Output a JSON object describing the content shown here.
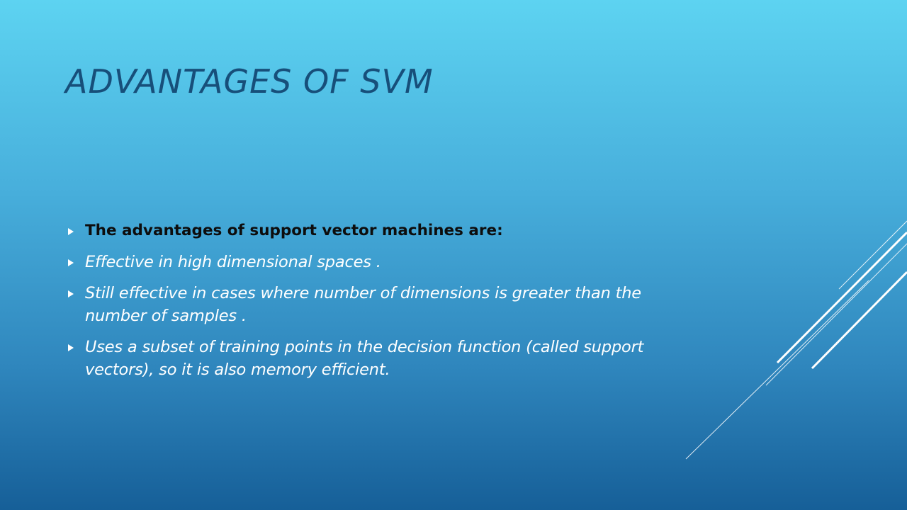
{
  "slide": {
    "title": "ADVANTAGES OF SVM",
    "bullets": [
      "The advantages of support vector machines are:",
      "Effective in high dimensional spaces .",
      "Still effective in cases where number of dimensions is greater than the number of samples .",
      "Uses a subset of training points in the decision function (called support vectors), so it is also memory efficient."
    ]
  },
  "colors": {
    "background_top": "#5dd3f1",
    "background_bottom": "#165f98",
    "title": "#174f7a",
    "body_text": "#ffffff",
    "lead_text": "#0d0d0d"
  }
}
